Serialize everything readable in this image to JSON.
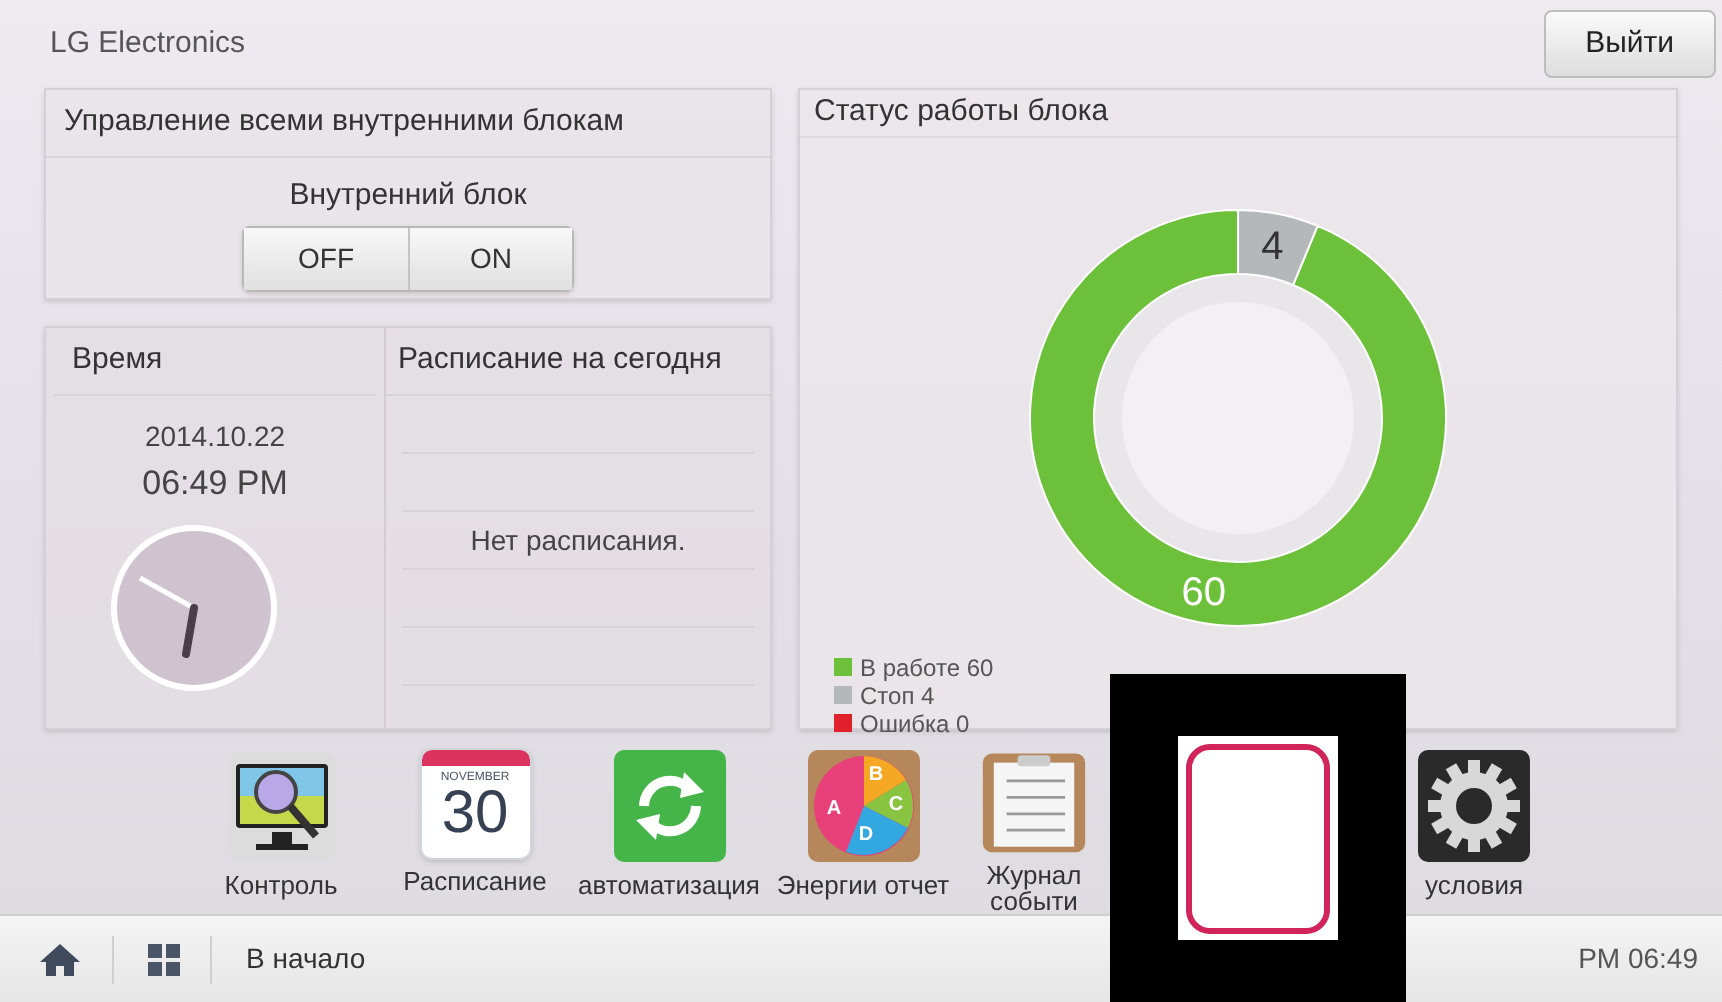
{
  "header": {
    "brand": "LG Electronics",
    "logout_button": "Выйти"
  },
  "all_units": {
    "title": "Управление всеми внутренними блокам",
    "control_label": "Внутренний блок",
    "buttons": [
      "OFF",
      "ON"
    ]
  },
  "time": {
    "title": "Время",
    "date": "2014.10.22",
    "clock": "06:49 PM"
  },
  "schedule": {
    "title": "Расписание на сегодня",
    "empty_text": "Нет расписания."
  },
  "status": {
    "title": "Статус работы блока",
    "chart_data": {
      "type": "donut",
      "values": [
        60,
        4,
        0
      ],
      "data_labels": true
    },
    "legend": [
      {
        "label": "В работе 60",
        "color": "#6cc03a"
      },
      {
        "label": "Стоп 4",
        "color": "#b4b8bb"
      },
      {
        "label": "Ошибка 0",
        "color": "#e0202a"
      }
    ]
  },
  "dock": [
    {
      "kind": "monitor",
      "label": "Контроль"
    },
    {
      "kind": "calendar",
      "label": "Расписание",
      "month": "NOVEMBER",
      "day": "30"
    },
    {
      "kind": "sync",
      "label": "автоматизация"
    },
    {
      "kind": "pie",
      "label": "Энергии отчет",
      "letters": [
        "A",
        "B",
        "C",
        "D"
      ]
    },
    {
      "kind": "clipboard",
      "label": "Журнал событи"
    },
    {
      "kind": "gear",
      "label": "условия"
    }
  ],
  "status_bar": {
    "home_label": "В начало",
    "time": "PM 06:49"
  }
}
